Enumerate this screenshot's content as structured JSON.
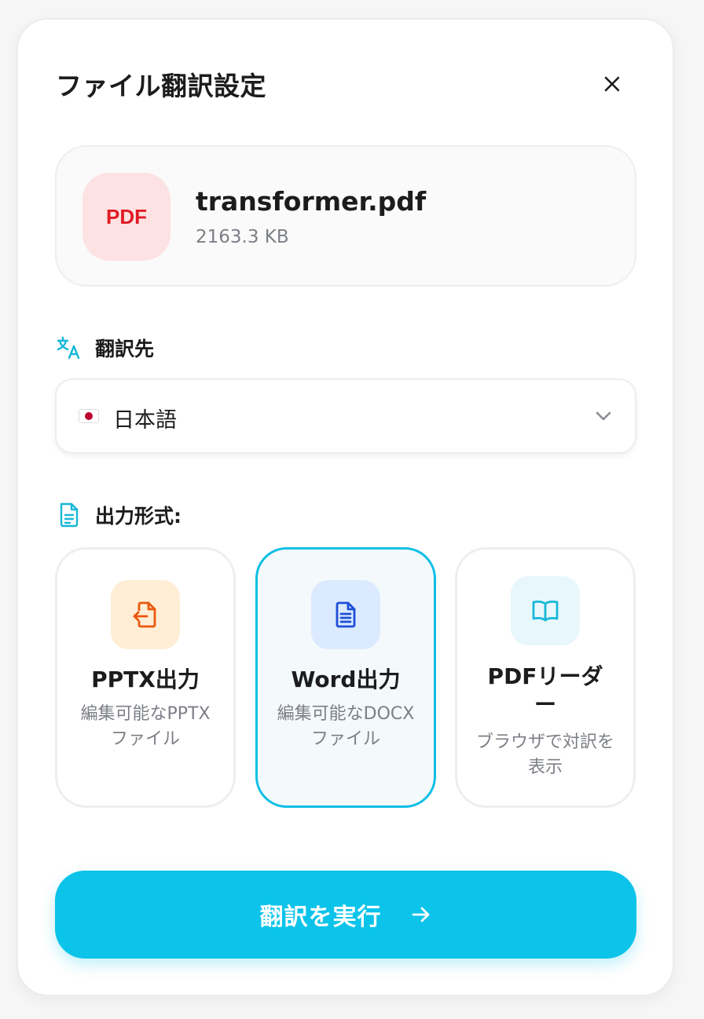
{
  "dialog": {
    "title": "ファイル翻訳設定"
  },
  "file": {
    "badge": "PDF",
    "name": "transformer.pdf",
    "size": "2163.3 KB"
  },
  "target_language": {
    "label": "翻訳先",
    "selected": "日本語",
    "flag_icon": "japan-flag-icon"
  },
  "output_format": {
    "label": "出力形式:",
    "options": [
      {
        "name": "PPTX出力",
        "description": "編集可能なPPTXファイル",
        "icon": "file-export-icon",
        "color": "#ea580c",
        "selected": false
      },
      {
        "name": "Word出力",
        "description": "編集可能なDOCXファイル",
        "icon": "document-icon",
        "color": "#1d4ed8",
        "selected": true
      },
      {
        "name": "PDFリーダー",
        "description": "ブラウザで対訳を表示",
        "icon": "book-open-icon",
        "color": "#17b8d8",
        "selected": false
      }
    ]
  },
  "actions": {
    "run_label": "翻訳を実行"
  },
  "colors": {
    "accent": "#0cc3e9",
    "pdf_badge_bg": "#fde2e3",
    "pdf_badge_text": "#e01b24"
  }
}
